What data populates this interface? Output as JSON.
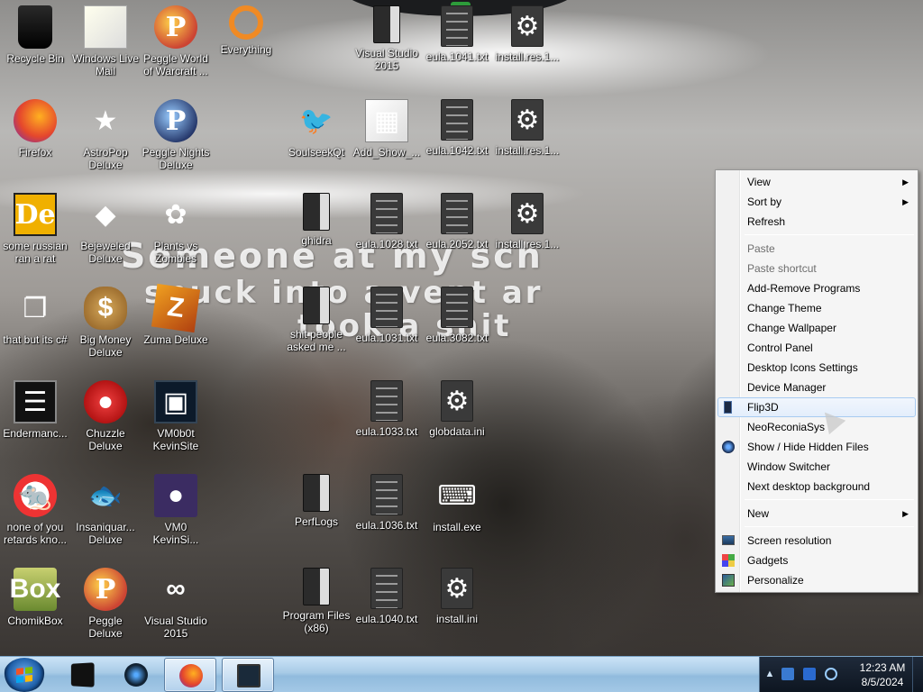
{
  "wallpaper": {
    "caption_line1": "Someone at my sch",
    "caption_line2": "snuck into a vent ar",
    "caption_line3": "took a shit"
  },
  "desktop_icons": {
    "recycle_bin": "Recycle Bin",
    "windows_live_mail": "Windows Live Mail",
    "peggle_world_of_warcraft": "Peggle World of Warcraft ...",
    "everything": "Everything",
    "visual_studio_2015_folder": "Visual Studio 2015",
    "eula_1041": "eula.1041.txt",
    "install_res_1": "install.res.1...",
    "firefox": "Firefox",
    "astropop_deluxe": "AstroPop Deluxe",
    "peggle_nights_deluxe": "Peggle Nights Deluxe",
    "soulseekqt": "SoulseekQt",
    "add_show": "Add_Show_...",
    "eula_1042": "eula.1042.txt",
    "install_res_2": "install.res.1...",
    "some_russian_ran_a_rat": "some russian ran a rat",
    "bejeweled_deluxe": "Bejeweled Deluxe",
    "plants_vs_zombies": "Plants vs Zombies",
    "ghidra": "ghidra",
    "eula_1028": "eula.1028.txt",
    "eula_2052": "eula.2052.txt",
    "install_res_3": "install.res.1...",
    "that_but_its_csharp": "that but its c#",
    "big_money_deluxe": "Big Money Deluxe",
    "zuma_deluxe": "Zuma Deluxe",
    "shit_people_asked_me": "shit people asked me ...",
    "eula_1031": "eula.1031.txt",
    "eula_3082": "eula.3082.txt",
    "endermanc": "Endermanc...",
    "chuzzle_deluxe": "Chuzzle Deluxe",
    "vm0b0t_kevinsite": "VM0b0t KevinSite",
    "eula_1033": "eula.1033.txt",
    "globdata_ini": "globdata.ini",
    "none_of_you": "none of you retards kno...",
    "insaniquarium_deluxe": "Insaniquar... Deluxe",
    "vm0_kevinsi": "VM0 KevinSi...",
    "perflogs": "PerfLogs",
    "eula_1036": "eula.1036.txt",
    "install_exe": "install.exe",
    "chomikbox": "ChomikBox",
    "peggle_deluxe": "Peggle Deluxe",
    "visual_studio_2015": "Visual Studio 2015",
    "program_files_x86": "Program Files (x86)",
    "eula_1040": "eula.1040.txt",
    "install_ini": "install.ini"
  },
  "context_menu": {
    "view": "View",
    "sort_by": "Sort by",
    "refresh": "Refresh",
    "paste": "Paste",
    "paste_shortcut": "Paste shortcut",
    "add_remove_programs": "Add-Remove Programs",
    "change_theme": "Change Theme",
    "change_wallpaper": "Change Wallpaper",
    "control_panel": "Control Panel",
    "desktop_icons_settings": "Desktop Icons Settings",
    "device_manager": "Device Manager",
    "flip3d": "Flip3D",
    "neoreconiasys": "NeoReconiaSys",
    "show_hide_hidden_files": "Show / Hide Hidden Files",
    "window_switcher": "Window Switcher",
    "next_desktop_background": "Next desktop background",
    "new": "New",
    "screen_resolution": "Screen resolution",
    "gadgets": "Gadgets",
    "personalize": "Personalize",
    "submenu_arrow": "▶",
    "highlighted_item": "Flip3D"
  },
  "taskbar": {
    "clock_time": "12:23 AM",
    "clock_date": "8/5/2024",
    "tray_chevron": "▲"
  },
  "colors": {
    "taskbar_top": "#cbe3f7",
    "menu_hover_border": "#a8cbf1",
    "tray_bg": "#1f2a3a"
  }
}
